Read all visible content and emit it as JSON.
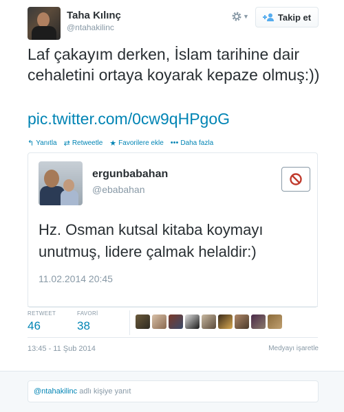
{
  "author": {
    "display_name": "Taha Kılınç",
    "screen_name": "@ntahakilinc"
  },
  "header": {
    "follow_label": "Takip et"
  },
  "tweet": {
    "text": "Laf çakayım derken, İslam tarihine dair cehaletini ortaya koyarak kepaze olmuş:))",
    "link": "pic.twitter.com/0cw9qHPgoG"
  },
  "actions": {
    "reply": "Yanıtla",
    "retweet": "Retweetle",
    "favorite": "Favorilere ekle",
    "more": "Daha fazla"
  },
  "quoted": {
    "display_name": "ergunbabahan",
    "screen_name": "@ebabahan",
    "text": "Hz. Osman kutsal kitaba koymayı unutmuş, lidere çalmak helaldir:)",
    "date": "11.02.2014 20:45"
  },
  "stats": {
    "retweet_label": "RETWEET",
    "retweet_count": "46",
    "favorite_label": "FAVORİ",
    "favorite_count": "38"
  },
  "footer": {
    "timestamp": "13:45 - 11 Şub 2014",
    "flag_media": "Medyayı işaretle"
  },
  "reply": {
    "mention": "@ntahakilinc",
    "placeholder_rest": "adlı kişiye yanıt"
  },
  "colors": {
    "link": "#0084b4",
    "muted": "#8899a6",
    "text": "#292f33",
    "block": "#c0392b"
  },
  "icons": [
    "gear-icon",
    "follow-person-icon",
    "reply-icon",
    "retweet-icon",
    "star-icon",
    "more-icon",
    "block-icon"
  ]
}
